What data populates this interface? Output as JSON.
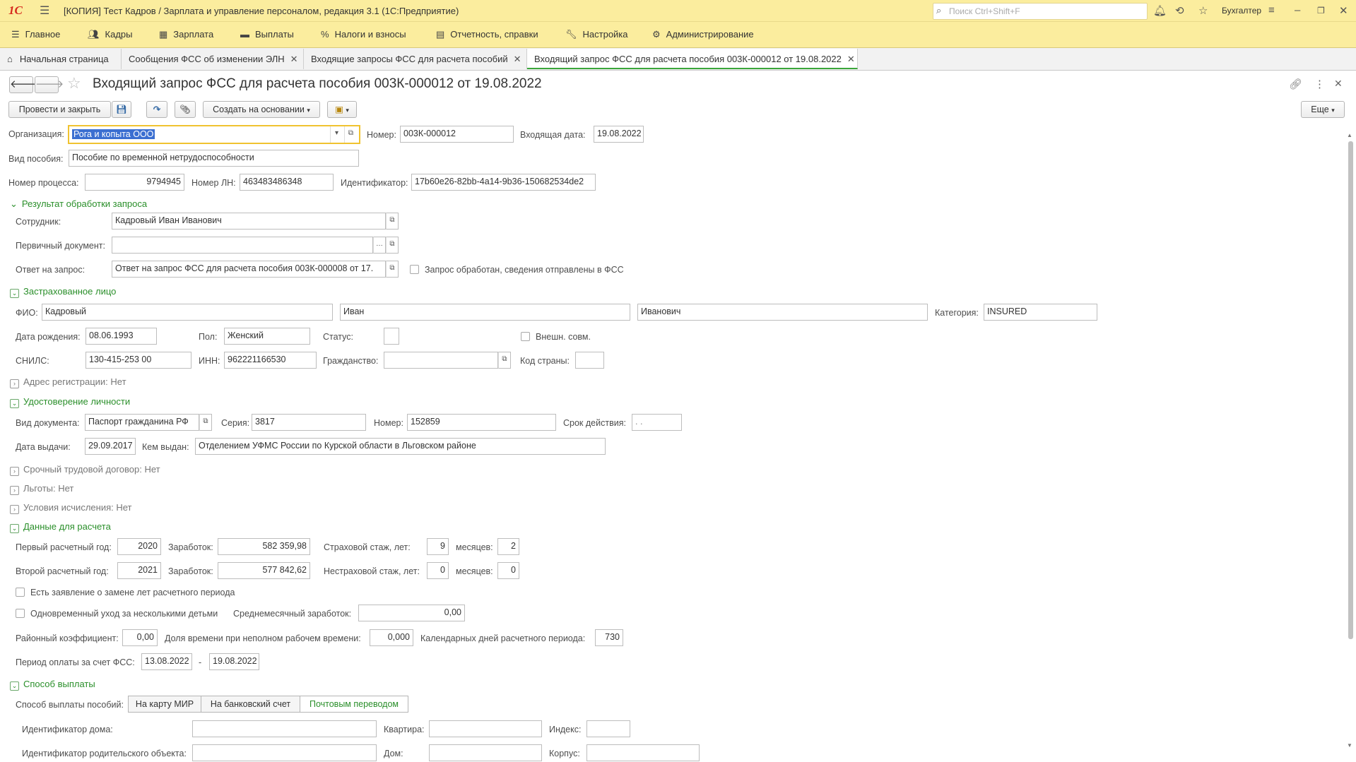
{
  "app": {
    "logo": "1С",
    "title": "[КОПИЯ] Тест Кадров / Зарплата и управление персоналом, редакция 3.1  (1С:Предприятие)",
    "search_placeholder": "Поиск Ctrl+Shift+F",
    "user": "Бухгалтер"
  },
  "menu": [
    {
      "label": "Главное",
      "icon": "hamburger-icon"
    },
    {
      "label": "Кадры",
      "icon": "people-icon"
    },
    {
      "label": "Зарплата",
      "icon": "calculator-icon"
    },
    {
      "label": "Выплаты",
      "icon": "wallet-icon"
    },
    {
      "label": "Налоги и взносы",
      "icon": "percent-icon"
    },
    {
      "label": "Отчетность, справки",
      "icon": "report-icon"
    },
    {
      "label": "Настройка",
      "icon": "wrench-icon"
    },
    {
      "label": "Администрирование",
      "icon": "gear-icon"
    }
  ],
  "tabs": [
    {
      "label": "Начальная страница"
    },
    {
      "label": "Сообщения ФСС об изменении ЭЛН"
    },
    {
      "label": "Входящие запросы ФСС для расчета пособий"
    },
    {
      "label": "Входящий запрос ФСС для расчета пособия 003К-000012 от 19.08.2022"
    }
  ],
  "doc": {
    "title": "Входящий запрос ФСС для расчета пособия 003К-000012 от 19.08.2022",
    "post_close": "Провести и закрыть",
    "create_based": "Создать на основании",
    "more": "Еще"
  },
  "form": {
    "org_label": "Организация:",
    "org_value": "Рога и копыта ООО",
    "number_label": "Номер:",
    "number_value": "003К-000012",
    "in_date_label": "Входящая дата:",
    "in_date_value": "19.08.2022",
    "benefit_label": "Вид пособия:",
    "benefit_value": "Пособие по временной нетрудоспособности",
    "proc_label": "Номер процесса:",
    "proc_value": "9794945",
    "ln_label": "Номер ЛН:",
    "ln_value": "463483486348",
    "id_label": "Идентификатор:",
    "id_value": "17b60e26-82bb-4a14-9b36-150682534de2"
  },
  "result": {
    "title": "Результат обработки запроса",
    "employee_label": "Сотрудник:",
    "employee_value": "Кадровый Иван Иванович",
    "primary_label": "Первичный документ:",
    "primary_value": "",
    "answer_label": "Ответ на запрос:",
    "answer_value": "Ответ на запрос ФСС для расчета пособия 003К-000008 от 17.",
    "processed_label": "Запрос обработан, сведения отправлены в ФСС"
  },
  "insured": {
    "title": "Застрахованное лицо",
    "fio_label": "ФИО:",
    "last": "Кадровый",
    "first": "Иван",
    "middle": "Иванович",
    "cat_label": "Категория:",
    "cat_value": "INSURED",
    "dob_label": "Дата рождения:",
    "dob_value": "08.06.1993",
    "sex_label": "Пол:",
    "sex_value": "Женский",
    "status_label": "Статус:",
    "status_value": "",
    "ext_label": "Внешн. совм.",
    "snils_label": "СНИЛС:",
    "snils_value": "130-415-253 00",
    "inn_label": "ИНН:",
    "inn_value": "962221166530",
    "citizen_label": "Гражданство:",
    "citizen_value": "",
    "country_label": "Код страны:",
    "country_value": ""
  },
  "address": {
    "title": "Адрес регистрации: Нет"
  },
  "identity": {
    "title": "Удостоверение личности",
    "doctype_label": "Вид документа:",
    "doctype_value": "Паспорт гражданина РФ",
    "series_label": "Серия:",
    "series_value": "3817",
    "num_label": "Номер:",
    "num_value": "152859",
    "valid_label": "Срок действия:",
    "valid_value": " .  .",
    "issued_label": "Дата выдачи:",
    "issued_value": "29.09.2017",
    "by_label": "Кем выдан:",
    "by_value": "Отделением УФМС России по Курской области в Льговском районе"
  },
  "collapsed": {
    "contract": "Срочный трудовой договор: Нет",
    "benefits": "Льготы: Нет",
    "calc": "Условия исчисления: Нет"
  },
  "calcdata": {
    "title": "Данные для расчета",
    "y1_label": "Первый расчетный год:",
    "y1": "2020",
    "earn1_label": "Заработок:",
    "earn1": "582 359,98",
    "ins_label": "Страховой стаж, лет:",
    "ins_years": "9",
    "months_label": "месяцев:",
    "ins_months": "2",
    "y2_label": "Второй расчетный год:",
    "y2": "2021",
    "earn2_label": "Заработок:",
    "earn2": "577 842,62",
    "nonins_label": "Нестраховой стаж, лет:",
    "nonins_years": "0",
    "months2_label": "месяцев:",
    "nonins_months": "0",
    "replace_label": "Есть заявление о замене лет расчетного периода",
    "multi_label": "Одновременный уход за несколькими детьми",
    "avg_label": "Среднемесячный заработок:",
    "avg_value": "0,00",
    "rk_label": "Районный коэффициент:",
    "rk_value": "0,00",
    "part_label": "Доля времени при неполном рабочем времени:",
    "part_value": "0,000",
    "days_label": "Календарных дней расчетного периода:",
    "days_value": "730",
    "period_label": "Период оплаты за счет ФСС:",
    "period_from": "13.08.2022",
    "dash": "-",
    "period_to": "19.08.2022"
  },
  "payment": {
    "title": "Способ выплаты",
    "method_label": "Способ выплаты пособий:",
    "options": [
      "На карту МИР",
      "На банковский счет",
      "Почтовым переводом"
    ],
    "house_label": "Идентификатор дома:",
    "flat_label": "Квартира:",
    "index_label": "Индекс:",
    "parent_label": "Идентификатор родительского объекта:",
    "dom_label": "Дом:",
    "korpus_label": "Корпус:"
  }
}
